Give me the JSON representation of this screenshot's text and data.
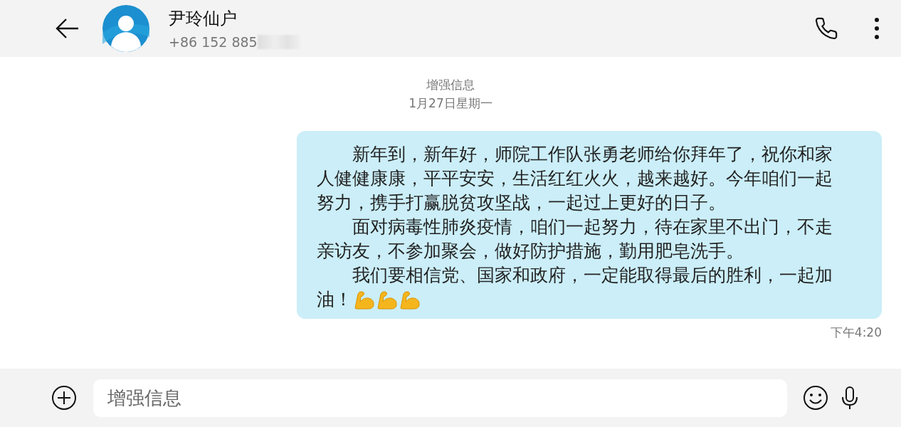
{
  "header": {
    "contact_name": "尹玲仙户",
    "phone": "+86 152 885"
  },
  "thread": {
    "label": "增强信息",
    "date": "1月27日星期一"
  },
  "message": {
    "paragraphs": [
      [
        "新年到，新年好，师院工作队张勇老师给你拜年了，祝你和家",
        "人健健康康，平平安安，生活红红火火，越来越好。今年咱们一起",
        "努力，携手打赢脱贫攻坚战，一起过上更好的日子。"
      ],
      [
        "面对病毒性肺炎疫情，咱们一起努力，待在家里不出门，不走",
        "亲访友，不参加聚会，做好防护措施，勤用肥皂洗手。"
      ],
      [
        "我们要相信党、国家和政府，一定能取得最后的胜利，一起加",
        "油！"
      ]
    ],
    "time": "下午4:20"
  },
  "composer": {
    "placeholder": "增强信息"
  }
}
